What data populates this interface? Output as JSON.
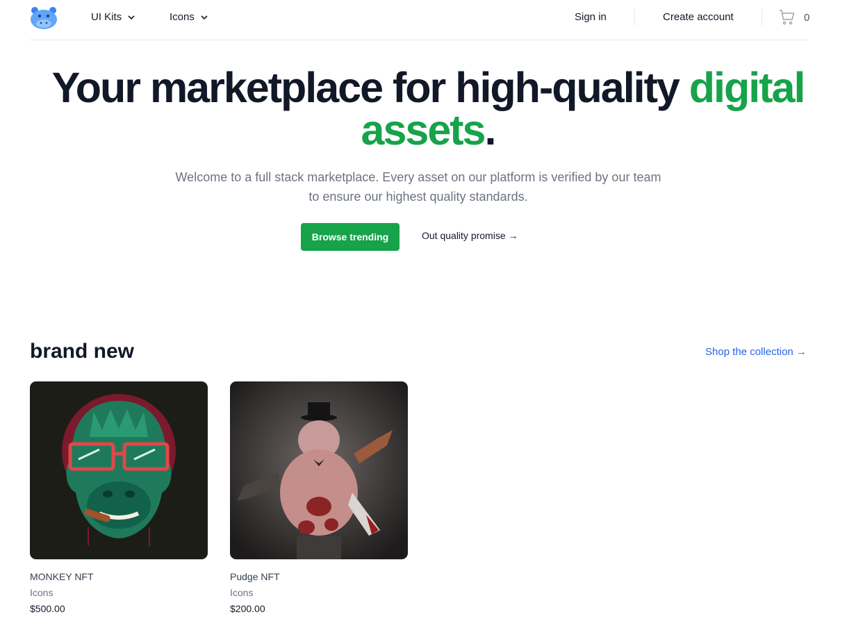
{
  "nav": {
    "ui_kits": "UI Kits",
    "icons": "Icons",
    "sign_in": "Sign in",
    "create_account": "Create account",
    "cart_count": "0"
  },
  "hero": {
    "title_part1": "Your marketplace for high-quality ",
    "title_accent": "digital assets",
    "title_end": ".",
    "subtitle": "Welcome to a full stack marketplace. Every asset on our platform is verified by our team to ensure our highest quality standards.",
    "primary_button": "Browse trending",
    "secondary_link": "Out quality promise →"
  },
  "section": {
    "title": "brand new",
    "link": "Shop the collection →"
  },
  "products": [
    {
      "name": "MONKEY NFT",
      "category": "Icons",
      "price": "$500.00"
    },
    {
      "name": "Pudge NFT",
      "category": "Icons",
      "price": "$200.00"
    }
  ],
  "colors": {
    "accent": "#16a34a",
    "link": "#2563eb",
    "logo": "#60a5fa"
  }
}
